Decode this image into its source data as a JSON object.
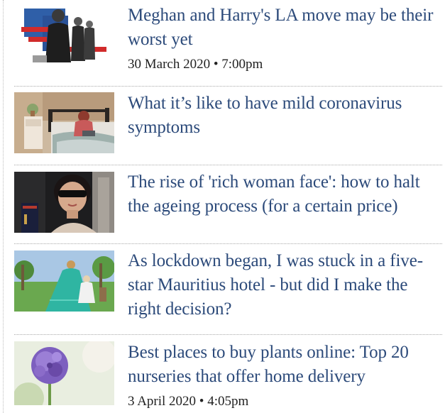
{
  "articles": [
    {
      "headline": "Meghan and Harry's LA move may be their worst yet",
      "date": "30 March 2020 • 7:00pm",
      "image": "collage-political-figures"
    },
    {
      "headline": "What it’s like to have mild coronavirus symptoms",
      "image": "woman-on-bed-laptop"
    },
    {
      "headline": "The rise of 'rich woman face': how to halt the ageing process (for a certain price)",
      "image": "woman-sunglasses-portrait"
    },
    {
      "headline": "As lockdown began, I was stuck in a five-star Mauritius hotel - but did I make the right decision?",
      "image": "mother-child-garden"
    },
    {
      "headline": "Best places to buy plants online: Top 20 nurseries that offer home delivery",
      "date": "3 April 2020 • 4:05pm",
      "image": "purple-allium-flower"
    }
  ],
  "colors": {
    "headline": "#2c4a7a",
    "date": "#222222",
    "separator": "#a9a9a9"
  }
}
